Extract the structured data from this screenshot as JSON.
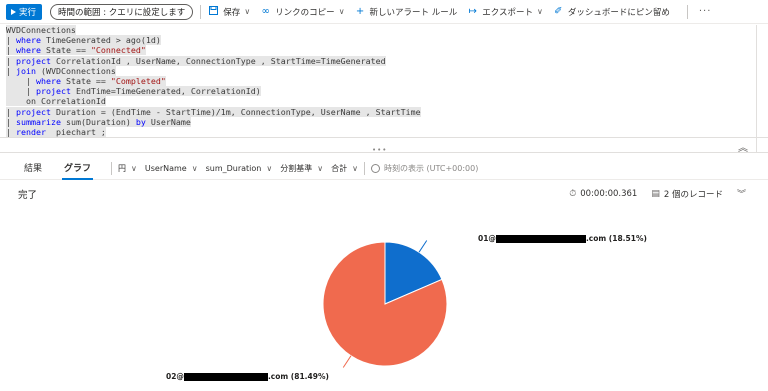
{
  "toolbar": {
    "run_label": "実行",
    "scope_label": "時間の範囲 : クエリに設定します",
    "save_label": "保存",
    "copy_link_label": "リンクのコピー",
    "new_alert_label": "新しいアラート ルール",
    "export_label": "エクスポート",
    "pin_label": "ダッシュボードにピン留め",
    "more_label": "···"
  },
  "editor": {
    "lines": [
      "WVDConnections",
      "| where TimeGenerated > ago(1d)",
      "| where State == \"Connected\"",
      "| project CorrelationId , UserName, ConnectionType , StartTime=TimeGenerated",
      "| join (WVDConnections",
      "    | where State == \"Completed\"",
      "    | project EndTime=TimeGenerated, CorrelationId)",
      "    on CorrelationId",
      "| project Duration = (EndTime - StartTime)/1m, ConnectionType, UserName , StartTime",
      "| summarize sum(Duration) by UserName",
      "| render  piechart ;"
    ]
  },
  "result_tabs": {
    "results_label": "結果",
    "chart_label": "グラフ"
  },
  "chart_options": {
    "chart_type": "円",
    "x_column": "UserName",
    "y_column": "sum_Duration",
    "split_by": "分割基準",
    "aggregation": "合計",
    "time_display": "時刻の表示 (UTC+00:00)"
  },
  "status": {
    "state": "完了",
    "duration": "00:00:00.361",
    "record_count": "2 個のレコード"
  },
  "colors": {
    "accent": "#0078d4",
    "slice_1": "#0f6ecd",
    "slice_2": "#f06a4e"
  },
  "chart_data": {
    "type": "pie",
    "slices": [
      {
        "label_prefix": "01@",
        "label_suffix": ".com (18.51%)",
        "value": 18.51,
        "color": "#0f6ecd"
      },
      {
        "label_prefix": "02@",
        "label_suffix": ".com (81.49%)",
        "value": 81.49,
        "color": "#f06a4e"
      }
    ]
  }
}
